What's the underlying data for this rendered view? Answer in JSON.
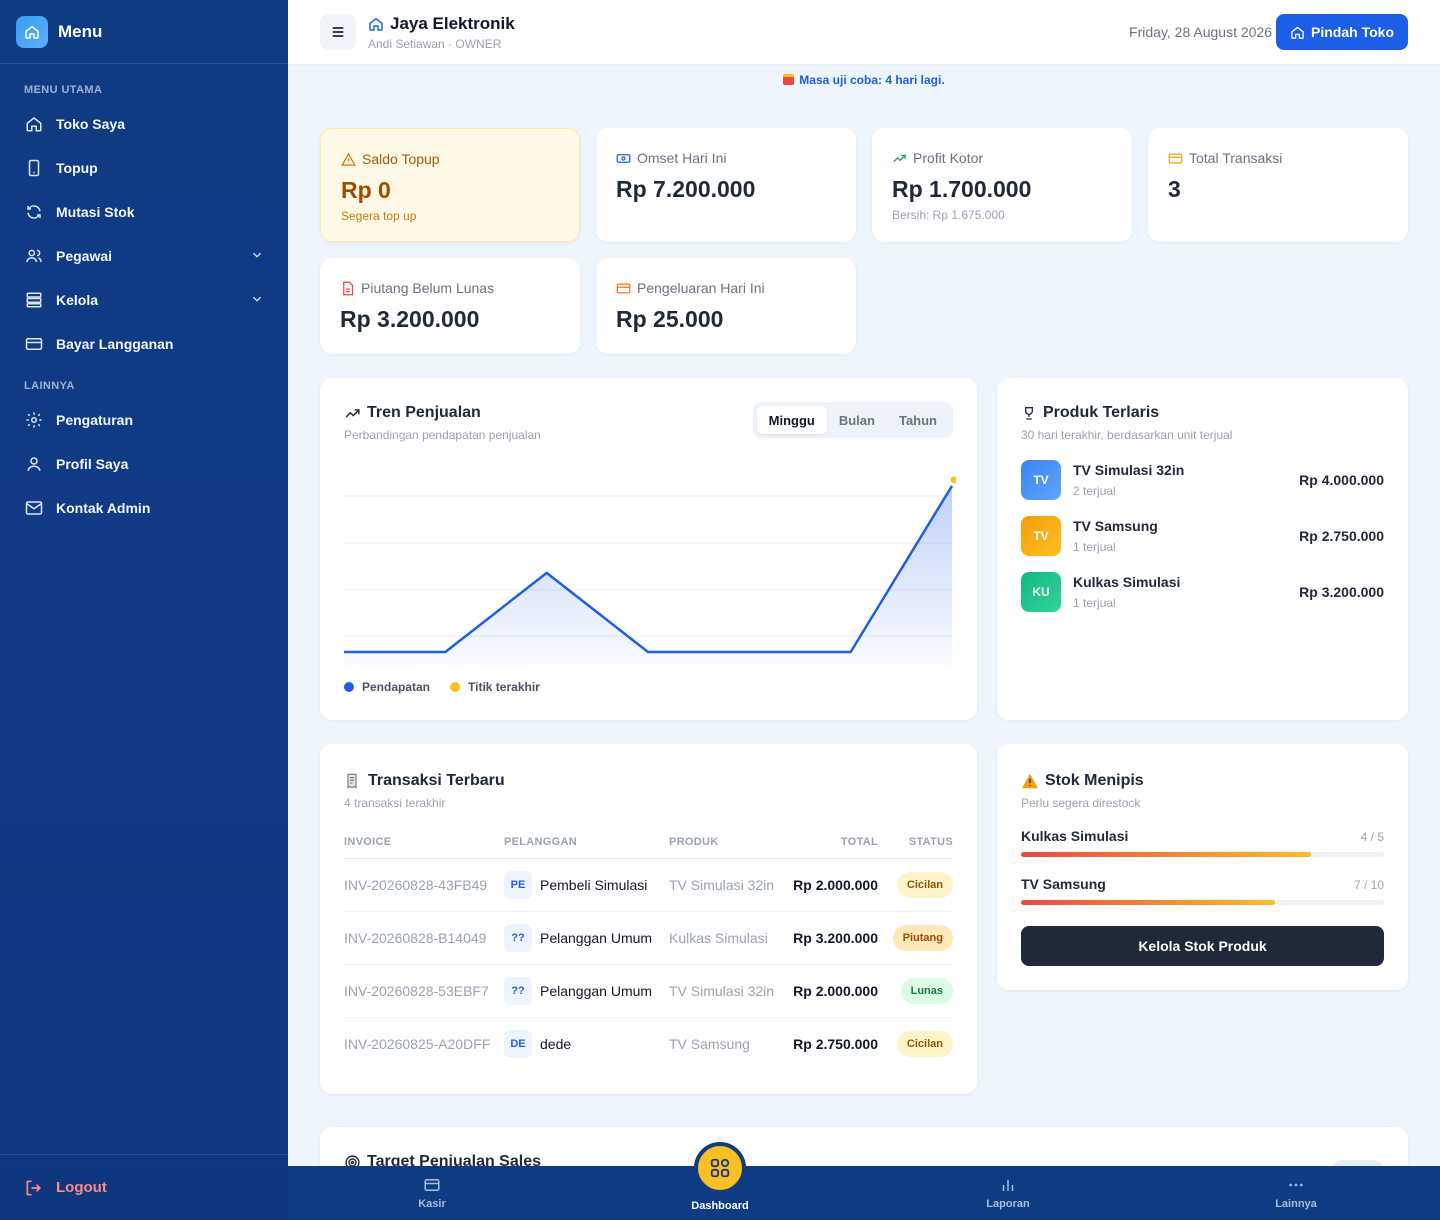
{
  "sidebar": {
    "title": "Menu",
    "section_main": "MENU UTAMA",
    "section_other": "LAINNYA",
    "items_main": [
      {
        "label": "Toko Saya",
        "icon": "home-icon"
      },
      {
        "label": "Topup",
        "icon": "phone-icon"
      },
      {
        "label": "Mutasi Stok",
        "icon": "refresh-icon"
      },
      {
        "label": "Pegawai",
        "icon": "users-icon"
      },
      {
        "label": "Kelola",
        "icon": "server-icon"
      },
      {
        "label": "Bayar Langganan",
        "icon": "card-icon"
      }
    ],
    "items_other": [
      {
        "label": "Pengaturan",
        "icon": "gear-icon"
      },
      {
        "label": "Profil Saya",
        "icon": "user-icon"
      },
      {
        "label": "Kontak Admin",
        "icon": "mail-icon"
      }
    ],
    "logout": "Logout"
  },
  "header": {
    "store_name": "Jaya Elektronik",
    "owner": "Andi Setiawan · OWNER",
    "date": "Friday, 28 August 2026",
    "switch_button": "Pindah Toko"
  },
  "trial_notice": "Masa uji coba: 4 hari lagi.",
  "stats": {
    "saldo": {
      "label": "Saldo Topup",
      "value": "Rp 0",
      "sub": "Segera top up"
    },
    "omset": {
      "label": "Omset Hari Ini",
      "value": "Rp 7.200.000"
    },
    "profit": {
      "label": "Profit Kotor",
      "value": "Rp 1.700.000",
      "sub": "Bersih: Rp 1.675.000"
    },
    "transaksi": {
      "label": "Total Transaksi",
      "value": "3"
    },
    "piutang": {
      "label": "Piutang Belum Lunas",
      "value": "Rp 3.200.000"
    },
    "pengeluaran": {
      "label": "Pengeluaran Hari Ini",
      "value": "Rp 25.000"
    }
  },
  "trend": {
    "title": "Tren Penjualan",
    "subtitle": "Perbandingan pendapatan penjualan",
    "tabs": [
      "Minggu",
      "Bulan",
      "Tahun"
    ],
    "active_tab": "Minggu",
    "legend_revenue": "Pendapatan",
    "legend_last": "Titik terakhir",
    "colors": {
      "line": "#1d5ee6",
      "last_point": "#fbbf24"
    }
  },
  "chart_data": {
    "type": "line",
    "x": [
      1,
      2,
      3,
      4,
      5,
      6,
      7
    ],
    "series": [
      {
        "name": "Pendapatan",
        "values": [
          0,
          0,
          2000000,
          0,
          0,
          0,
          4200000
        ]
      }
    ],
    "ylim": [
      0,
      4500000
    ],
    "grid": true,
    "legend": "bottom-left"
  },
  "best_products": {
    "title": "Produk Terlaris",
    "subtitle": "30 hari terakhir, berdasarkan unit terjual",
    "items": [
      {
        "initials": "TV",
        "name": "TV Simulasi 32in",
        "sold": "2 terjual",
        "price": "Rp 4.000.000",
        "color": "#3b82f6"
      },
      {
        "initials": "TV",
        "name": "TV Samsung",
        "sold": "1 terjual",
        "price": "Rp 2.750.000",
        "color": "#f59e0b"
      },
      {
        "initials": "KU",
        "name": "Kulkas Simulasi",
        "sold": "1 terjual",
        "price": "Rp 3.200.000",
        "color": "#10b981"
      }
    ]
  },
  "transactions": {
    "title": "Transaksi Terbaru",
    "subtitle": "4 transaksi terakhir",
    "columns": [
      "INVOICE",
      "PELANGGAN",
      "PRODUK",
      "TOTAL",
      "STATUS"
    ],
    "rows": [
      {
        "invoice": "INV-20260828-43FB49",
        "initials": "PE",
        "customer": "Pembeli Simulasi",
        "product": "TV Simulasi 32in",
        "total": "Rp 2.000.000",
        "status": "Cicilan"
      },
      {
        "invoice": "INV-20260828-B14049",
        "initials": "??",
        "customer": "Pelanggan Umum",
        "product": "Kulkas Simulasi",
        "total": "Rp 3.200.000",
        "status": "Piutang"
      },
      {
        "invoice": "INV-20260828-53EBF7",
        "initials": "??",
        "customer": "Pelanggan Umum",
        "product": "TV Simulasi 32in",
        "total": "Rp 2.000.000",
        "status": "Lunas"
      },
      {
        "invoice": "INV-20260825-A20DFF",
        "initials": "DE",
        "customer": "dede",
        "product": "TV Samsung",
        "total": "Rp 2.750.000",
        "status": "Cicilan"
      }
    ]
  },
  "low_stock": {
    "title": "Stok Menipis",
    "subtitle": "Perlu segera direstock",
    "items": [
      {
        "name": "Kulkas Simulasi",
        "qty": "4 / 5",
        "fraction": 0.8
      },
      {
        "name": "TV Samsung",
        "qty": "7 / 10",
        "fraction": 0.7
      }
    ],
    "button": "Kelola Stok Produk"
  },
  "sales_target": {
    "title": "Target Penjualan Sales"
  },
  "bottom_nav": {
    "kasir": "Kasir",
    "dashboard": "Dashboard",
    "laporan": "Laporan",
    "lainnya": "Lainnya"
  }
}
